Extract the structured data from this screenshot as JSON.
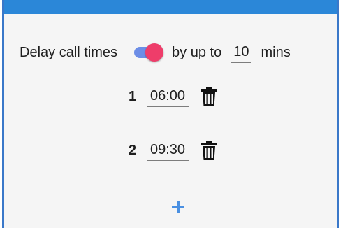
{
  "delay": {
    "label": "Delay call times",
    "toggle_on": true,
    "by_up_to_label": "by up to",
    "minutes_value": "10",
    "mins_label": "mins"
  },
  "times": [
    {
      "index": "1",
      "time": "06:00",
      "icon": "trash-icon"
    },
    {
      "index": "2",
      "time": "09:30",
      "icon": "trash-icon"
    }
  ],
  "add": {
    "icon": "plus-icon"
  },
  "colors": {
    "top_bar": "#2b87d8",
    "frame_border": "#3a78c9",
    "toggle_track": "#6c8de6",
    "toggle_thumb": "#ee3d6a",
    "add_icon": "#4a90e2"
  }
}
